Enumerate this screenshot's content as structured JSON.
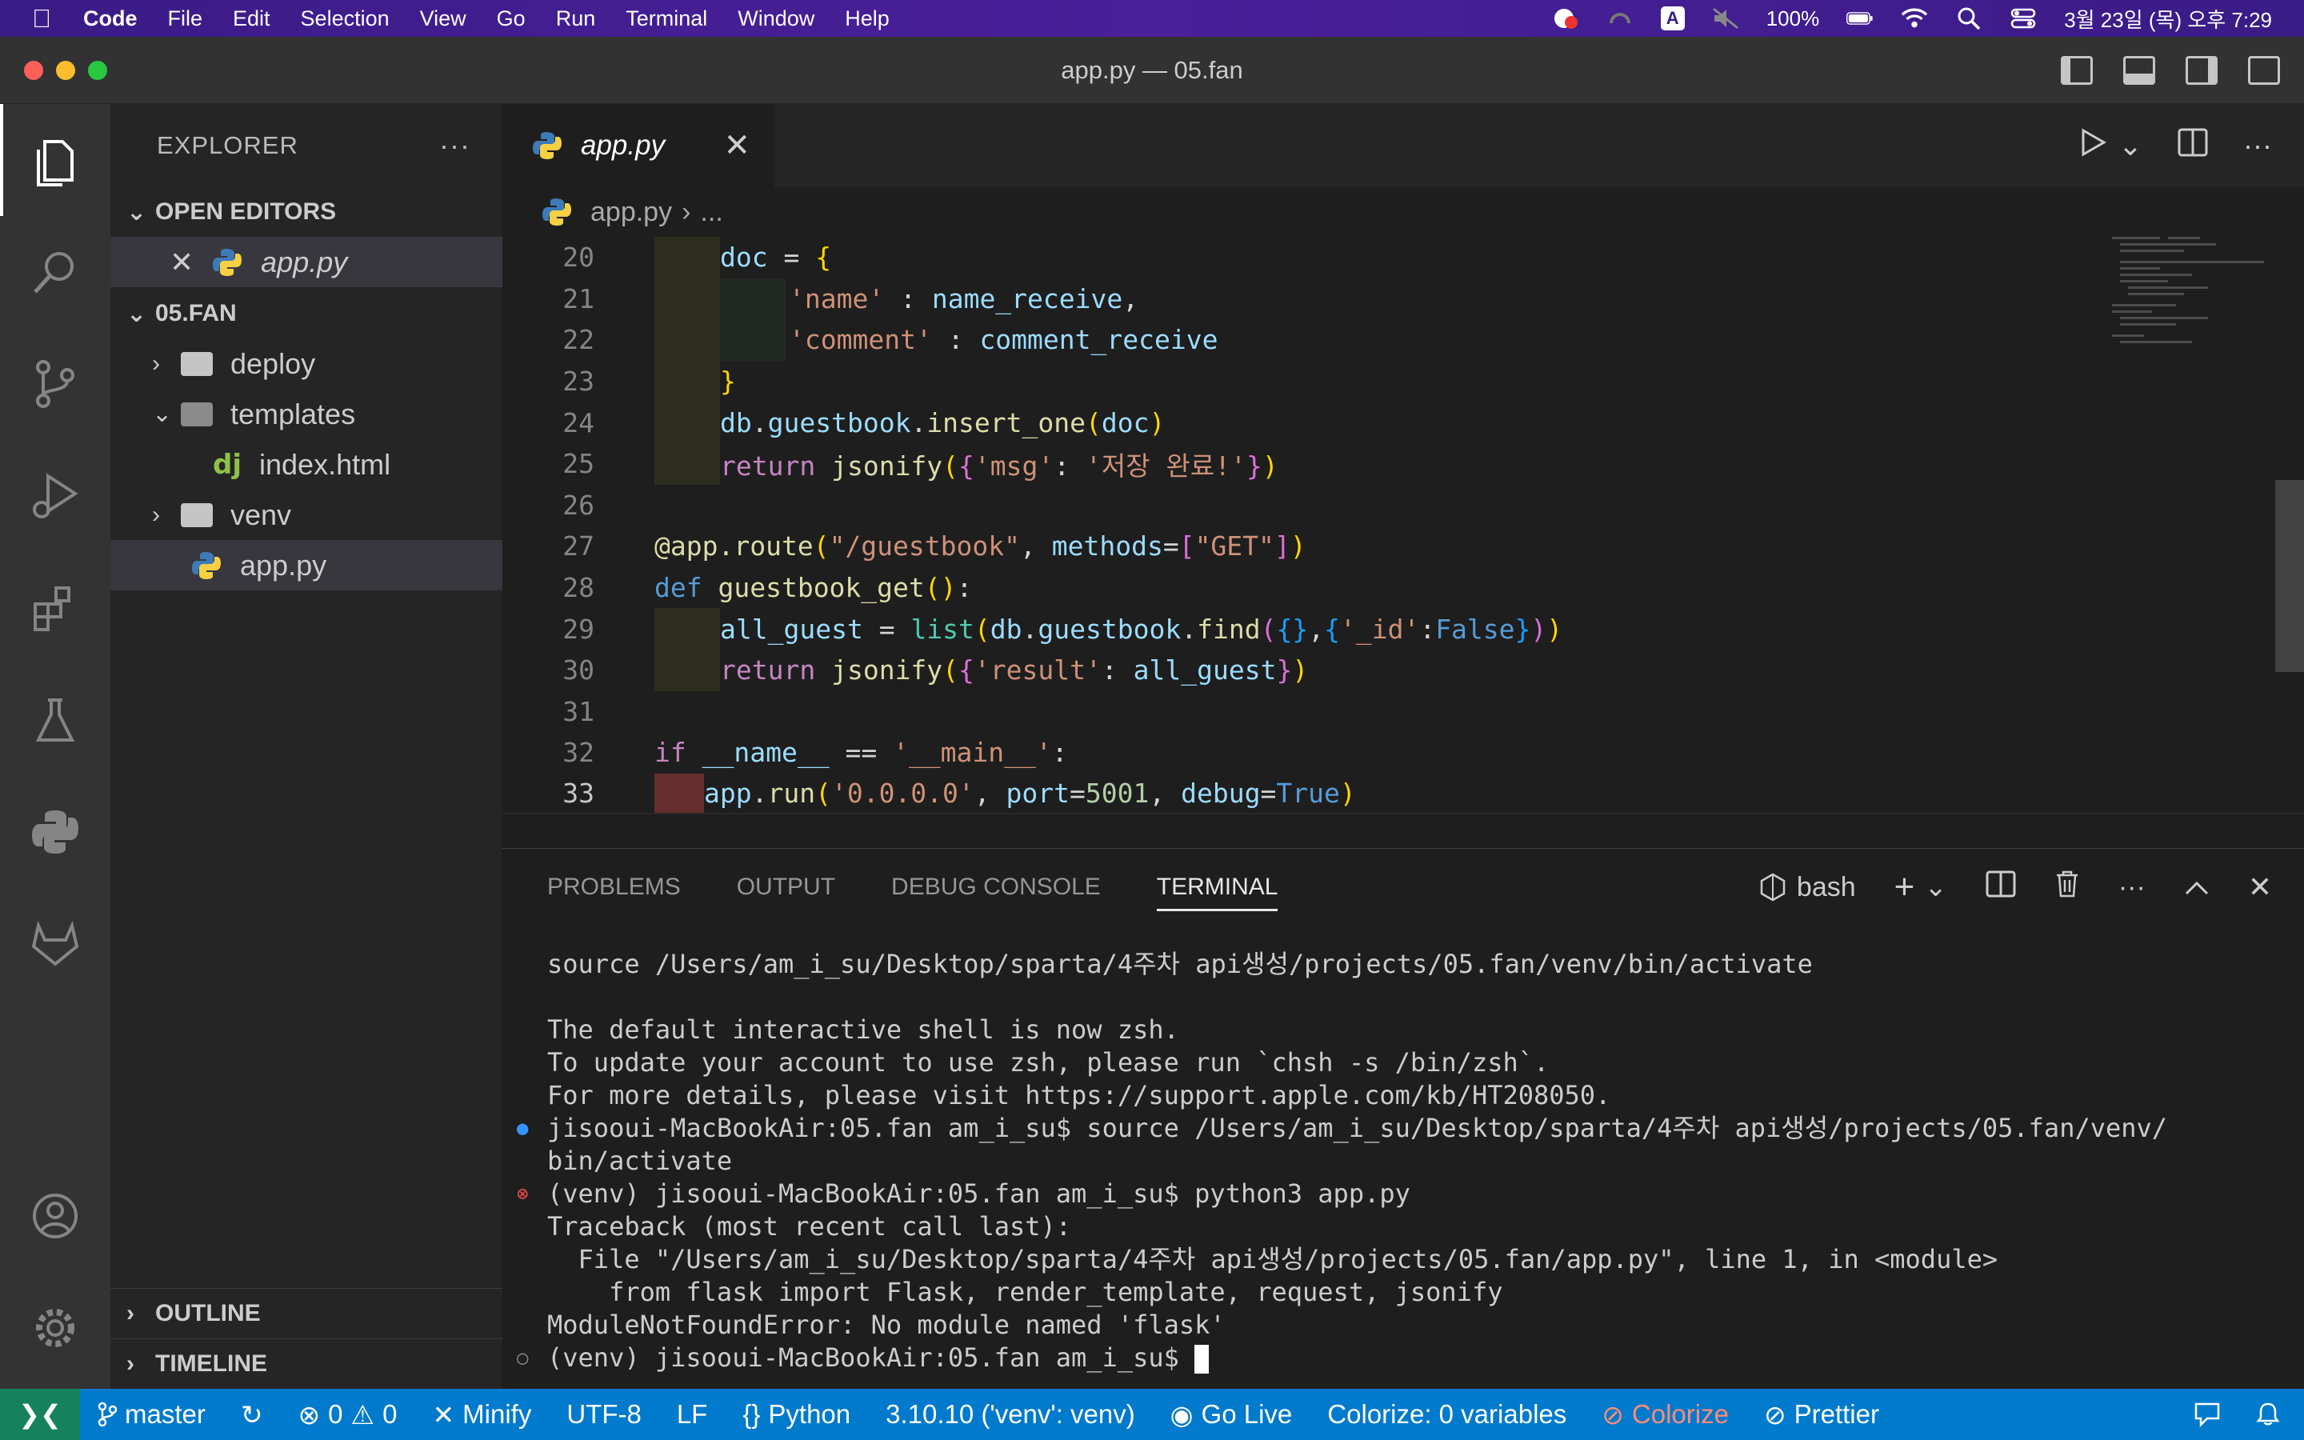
{
  "menubar": {
    "app_name": "Code",
    "items": [
      "File",
      "Edit",
      "Selection",
      "View",
      "Go",
      "Run",
      "Terminal",
      "Window",
      "Help"
    ],
    "input_indicator": "A",
    "battery": "100%",
    "datetime": "3월 23일 (목) 오후 7:29"
  },
  "window": {
    "title": "app.py — 05.fan"
  },
  "sidebar": {
    "header": "EXPLORER",
    "more": "···",
    "open_editors_label": "OPEN EDITORS",
    "open_editor_file": "app.py",
    "project_label": "05.FAN",
    "tree": [
      {
        "name": "deploy",
        "type": "folder",
        "expanded": false
      },
      {
        "name": "templates",
        "type": "folder",
        "expanded": true
      },
      {
        "name": "index.html",
        "type": "django"
      },
      {
        "name": "venv",
        "type": "folder",
        "expanded": false
      },
      {
        "name": "app.py",
        "type": "python"
      }
    ],
    "outline_label": "OUTLINE",
    "timeline_label": "TIMELINE"
  },
  "editor": {
    "tab_label": "app.py",
    "breadcrumb_file": "app.py",
    "breadcrumb_rest": "...",
    "line_numbers": [
      "20",
      "21",
      "22",
      "23",
      "24",
      "25",
      "26",
      "27",
      "28",
      "29",
      "30",
      "31",
      "32",
      "33"
    ],
    "current_line": "33"
  },
  "panel": {
    "tabs": [
      "PROBLEMS",
      "OUTPUT",
      "DEBUG CONSOLE",
      "TERMINAL"
    ],
    "active_tab": "TERMINAL",
    "shell": "bash",
    "terminal_lines": [
      "source /Users/am_i_su/Desktop/sparta/4주차 api생성/projects/05.fan/venv/bin/activate",
      "",
      "The default interactive shell is now zsh.",
      "To update your account to use zsh, please run `chsh -s /bin/zsh`.",
      "For more details, please visit https://support.apple.com/kb/HT208050.",
      "jisooui-MacBookAir:05.fan am_i_su$ source /Users/am_i_su/Desktop/sparta/4주차 api생성/projects/05.fan/venv/",
      "bin/activate",
      "(venv) jisooui-MacBookAir:05.fan am_i_su$ python3 app.py",
      "Traceback (most recent call last):",
      "  File \"/Users/am_i_su/Desktop/sparta/4주차 api생성/projects/05.fan/app.py\", line 1, in <module>",
      "    from flask import Flask, render_template, request, jsonify",
      "ModuleNotFoundError: No module named 'flask'",
      "(venv) jisooui-MacBookAir:05.fan am_i_su$ "
    ]
  },
  "statusbar": {
    "branch": "master",
    "errors": "0",
    "warnings": "0",
    "minify": "Minify",
    "encoding": "UTF-8",
    "eol": "LF",
    "language": "Python",
    "interpreter": "3.10.10 ('venv': venv)",
    "golive": "Go Live",
    "colorize_vars": "Colorize: 0 variables",
    "colorize": "Colorize",
    "prettier": "Prettier"
  },
  "colors": {
    "status_bar": "#007acc",
    "activity_bar": "#333333",
    "sidebar": "#252526",
    "editor_bg": "#1e1e1e",
    "menubar": "#3a1c86"
  }
}
